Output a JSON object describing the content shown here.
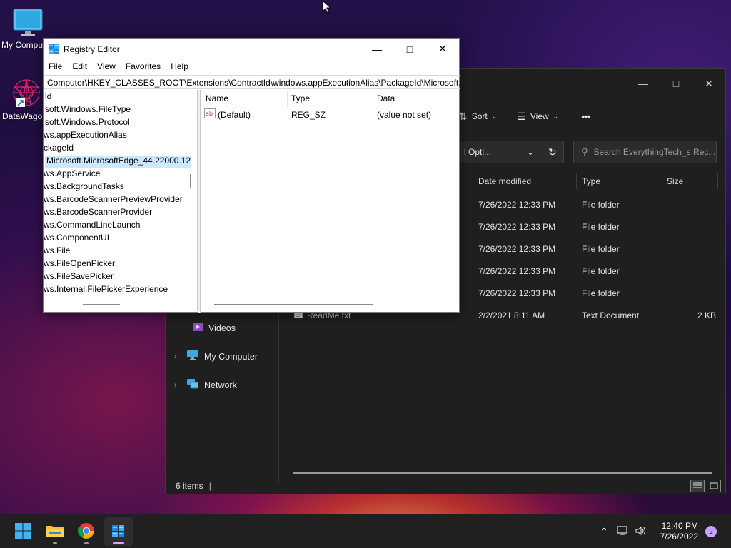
{
  "desktop": {
    "icons": [
      {
        "label": "My Comput"
      },
      {
        "label": "DataWago"
      }
    ]
  },
  "explorer": {
    "toolbar": {
      "sort": "Sort",
      "view": "View",
      "more": "•••"
    },
    "address_fragment": "l Opti...",
    "search_placeholder": "Search EverythingTech_s Rec...",
    "columns": {
      "date": "Date modified",
      "type": "Type",
      "size": "Size"
    },
    "rows": [
      {
        "name": "",
        "date": "7/26/2022 12:33 PM",
        "type": "File folder",
        "size": ""
      },
      {
        "name": "",
        "date": "7/26/2022 12:33 PM",
        "type": "File folder",
        "size": ""
      },
      {
        "name": "",
        "date": "7/26/2022 12:33 PM",
        "type": "File folder",
        "size": ""
      },
      {
        "name": "",
        "date": "7/26/2022 12:33 PM",
        "type": "File folder",
        "size": ""
      },
      {
        "name": "",
        "date": "7/26/2022 12:33 PM",
        "type": "File folder",
        "size": ""
      },
      {
        "name": "ReadMe.txt",
        "date": "2/2/2021 8:11 AM",
        "type": "Text Document",
        "size": "2 KB"
      }
    ],
    "nav": {
      "videos": "Videos",
      "my_computer": "My Computer",
      "network": "Network"
    },
    "status": "6 items"
  },
  "regedit": {
    "title": "Registry Editor",
    "menu": [
      "File",
      "Edit",
      "View",
      "Favorites",
      "Help"
    ],
    "address": "Computer\\HKEY_CLASSES_ROOT\\Extensions\\ContractId\\windows.appExecutionAlias\\PackageId\\Microsoft.M",
    "tree": [
      "ld",
      "soft.Windows.FileType",
      "soft.Windows.Protocol",
      "ws.appExecutionAlias",
      "ckageId",
      "Microsoft.MicrosoftEdge_44.22000.12",
      "ws.AppService",
      "ws.BackgroundTasks",
      "ws.BarcodeScannerPreviewProvider",
      "ws.BarcodeScannerProvider",
      "ws.CommandLineLaunch",
      "ws.ComponentUI",
      "ws.File",
      "ws.FileOpenPicker",
      "ws.FileSavePicker",
      "ws.Internal.FilePickerExperience"
    ],
    "selected_index": 5,
    "value_columns": {
      "name": "Name",
      "type": "Type",
      "data": "Data"
    },
    "values": [
      {
        "name": "(Default)",
        "type": "REG_SZ",
        "data": "(value not set)"
      }
    ]
  },
  "taskbar": {
    "apps": [
      "start",
      "file-explorer",
      "chrome",
      "registry-editor"
    ],
    "time": "12:40 PM",
    "date": "7/26/2022",
    "notification_count": "2"
  }
}
